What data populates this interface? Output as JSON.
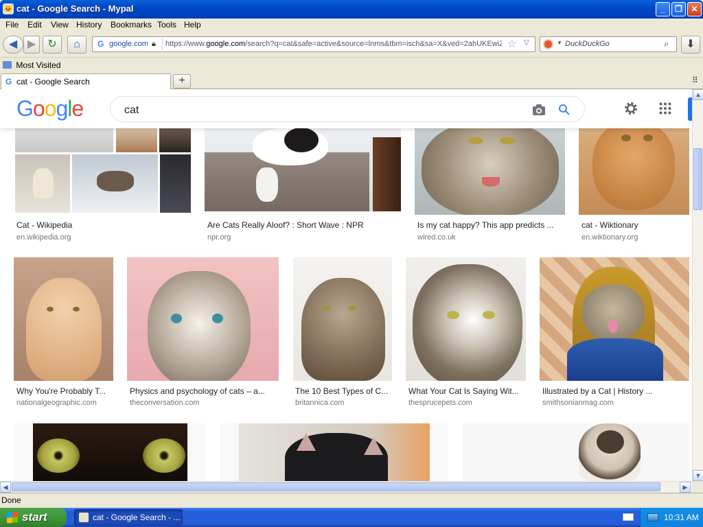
{
  "window": {
    "title": "cat - Google Search - Mypal"
  },
  "menu": [
    "File",
    "Edit",
    "View",
    "History",
    "Bookmarks",
    "Tools",
    "Help"
  ],
  "urlbar": {
    "identity": "google.com",
    "url_prefix": "https://www.",
    "url_host": "google.com",
    "url_rest": "/search?q=cat&safe=active&source=lnms&tbm=isch&sa=X&ved=2ahUKEwiZ"
  },
  "searchbar": {
    "placeholder": "DuckDuckGo"
  },
  "bookmarks": {
    "most_visited": "Most Visited"
  },
  "tabs": [
    {
      "label": "cat - Google Search"
    }
  ],
  "google": {
    "query": "cat"
  },
  "results": [
    {
      "caption": "Cat - Wikipedia",
      "source": "en.wikipedia.org"
    },
    {
      "caption": "Are Cats Really Aloof? : Short Wave : NPR",
      "source": "npr.org"
    },
    {
      "caption": "Is my cat happy? This app predicts ...",
      "source": "wired.co.uk"
    },
    {
      "caption": "cat - Wiktionary",
      "source": "en.wiktionary.org"
    },
    {
      "caption": "Why You're Probably T...",
      "source": "nationalgeographic.com"
    },
    {
      "caption": "Physics and psychology of cats – a...",
      "source": "theconversation.com"
    },
    {
      "caption": "The 10 Best Types of C...",
      "source": "britannica.com"
    },
    {
      "caption": "What Your Cat Is Saying Wit...",
      "source": "thesprucepets.com"
    },
    {
      "caption": "Illustrated by a Cat | History ...",
      "source": "smithsonianmag.com"
    }
  ],
  "status": "Done",
  "taskbar": {
    "start": "start",
    "item": "cat - Google Search - ...",
    "clock": "10:31 AM"
  },
  "colors": {
    "title_bar": "#0a5fd8",
    "taskbar": "#245edb",
    "start": "#3c943a",
    "google_blue": "#4285f4",
    "google_red": "#ea4335",
    "google_yellow": "#fbbc05",
    "google_green": "#34a853"
  }
}
